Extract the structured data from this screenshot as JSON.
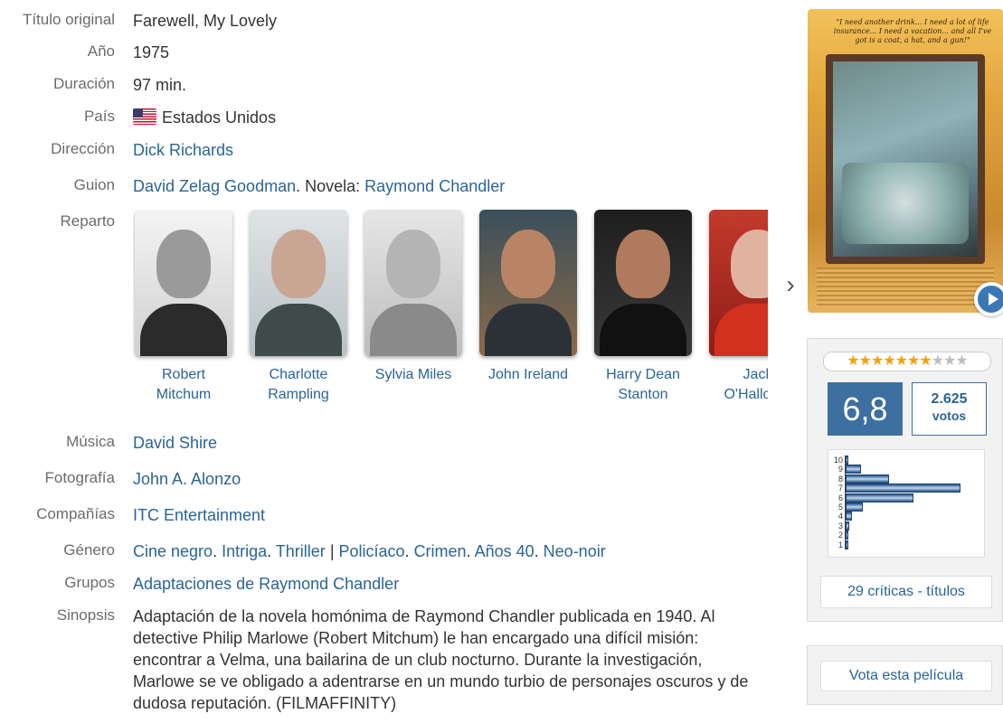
{
  "details": {
    "original_title": {
      "label": "Título original",
      "value": "Farewell, My Lovely"
    },
    "year": {
      "label": "Año",
      "value": "1975"
    },
    "duration": {
      "label": "Duración",
      "value": "97 min."
    },
    "country": {
      "label": "País",
      "value": "Estados Unidos",
      "flag_icon": "us-flag-icon"
    },
    "director": {
      "label": "Dirección",
      "value": "Dick Richards"
    },
    "screenplay": {
      "label": "Guion",
      "writer": "David Zelag Goodman",
      "novel_prefix": ". Novela: ",
      "novel_author": "Raymond Chandler"
    },
    "cast_label": "Reparto",
    "music": {
      "label": "Música",
      "value": "David Shire"
    },
    "photography": {
      "label": "Fotografía",
      "value": "John A. Alonzo"
    },
    "companies": {
      "label": "Compañías",
      "value": "ITC Entertainment"
    },
    "genre": {
      "label": "Género",
      "items": [
        "Cine negro",
        "Intriga",
        "Thriller",
        "Policíaco",
        "Crimen",
        "Años 40",
        "Neo-noir"
      ]
    },
    "groups": {
      "label": "Grupos",
      "value": "Adaptaciones de Raymond Chandler"
    },
    "synopsis": {
      "label": "Sinopsis",
      "value": "Adaptación de la novela homónima de Raymond Chandler publicada en 1940. Al detective Philip Marlowe (Robert Mitchum) le han encargado una difícil misión: encontrar a Velma, una bailarina de un club nocturno. Durante la investigación, Marlowe se ve obligado a adentrarse en un mundo turbio de personajes oscuros y de dudosa reputación. (FILMAFFINITY)"
    }
  },
  "cast": [
    {
      "name_line1": "Robert",
      "name_line2": "Mitchum"
    },
    {
      "name_line1": "Charlotte",
      "name_line2": "Rampling"
    },
    {
      "name_line1": "Sylvia Miles",
      "name_line2": ""
    },
    {
      "name_line1": "John Ireland",
      "name_line2": ""
    },
    {
      "name_line1": "Harry Dean",
      "name_line2": "Stanton"
    },
    {
      "name_line1": "Jack",
      "name_line2": "O'Halloran"
    }
  ],
  "carousel": {
    "next_icon": "chevron-right-icon",
    "next_glyph": "›"
  },
  "poster": {
    "quote": "\"I need another drink... I need a lot of life insurance... I need a vacation... and all I've got is a coat, a hat, and a gun!\""
  },
  "rating": {
    "stars_total": 10,
    "stars_filled": 7,
    "average": "6,8",
    "votes_count": "2.625",
    "votes_label": "votos",
    "histogram": {
      "labels": [
        "10",
        "9",
        "8",
        "7",
        "6",
        "5",
        "4",
        "3",
        "2",
        "1"
      ],
      "relative_values": [
        0.02,
        0.12,
        0.33,
        0.88,
        0.52,
        0.13,
        0.05,
        0.03,
        0.02,
        0.02
      ],
      "bar_color": "#1f4f86"
    },
    "critics_link": "29 críticas - títulos"
  },
  "vote_button": "Vota esta película",
  "colors": {
    "link": "#2a6496",
    "rating_accent": "#3d6fa0",
    "star": "#f2a20c"
  }
}
